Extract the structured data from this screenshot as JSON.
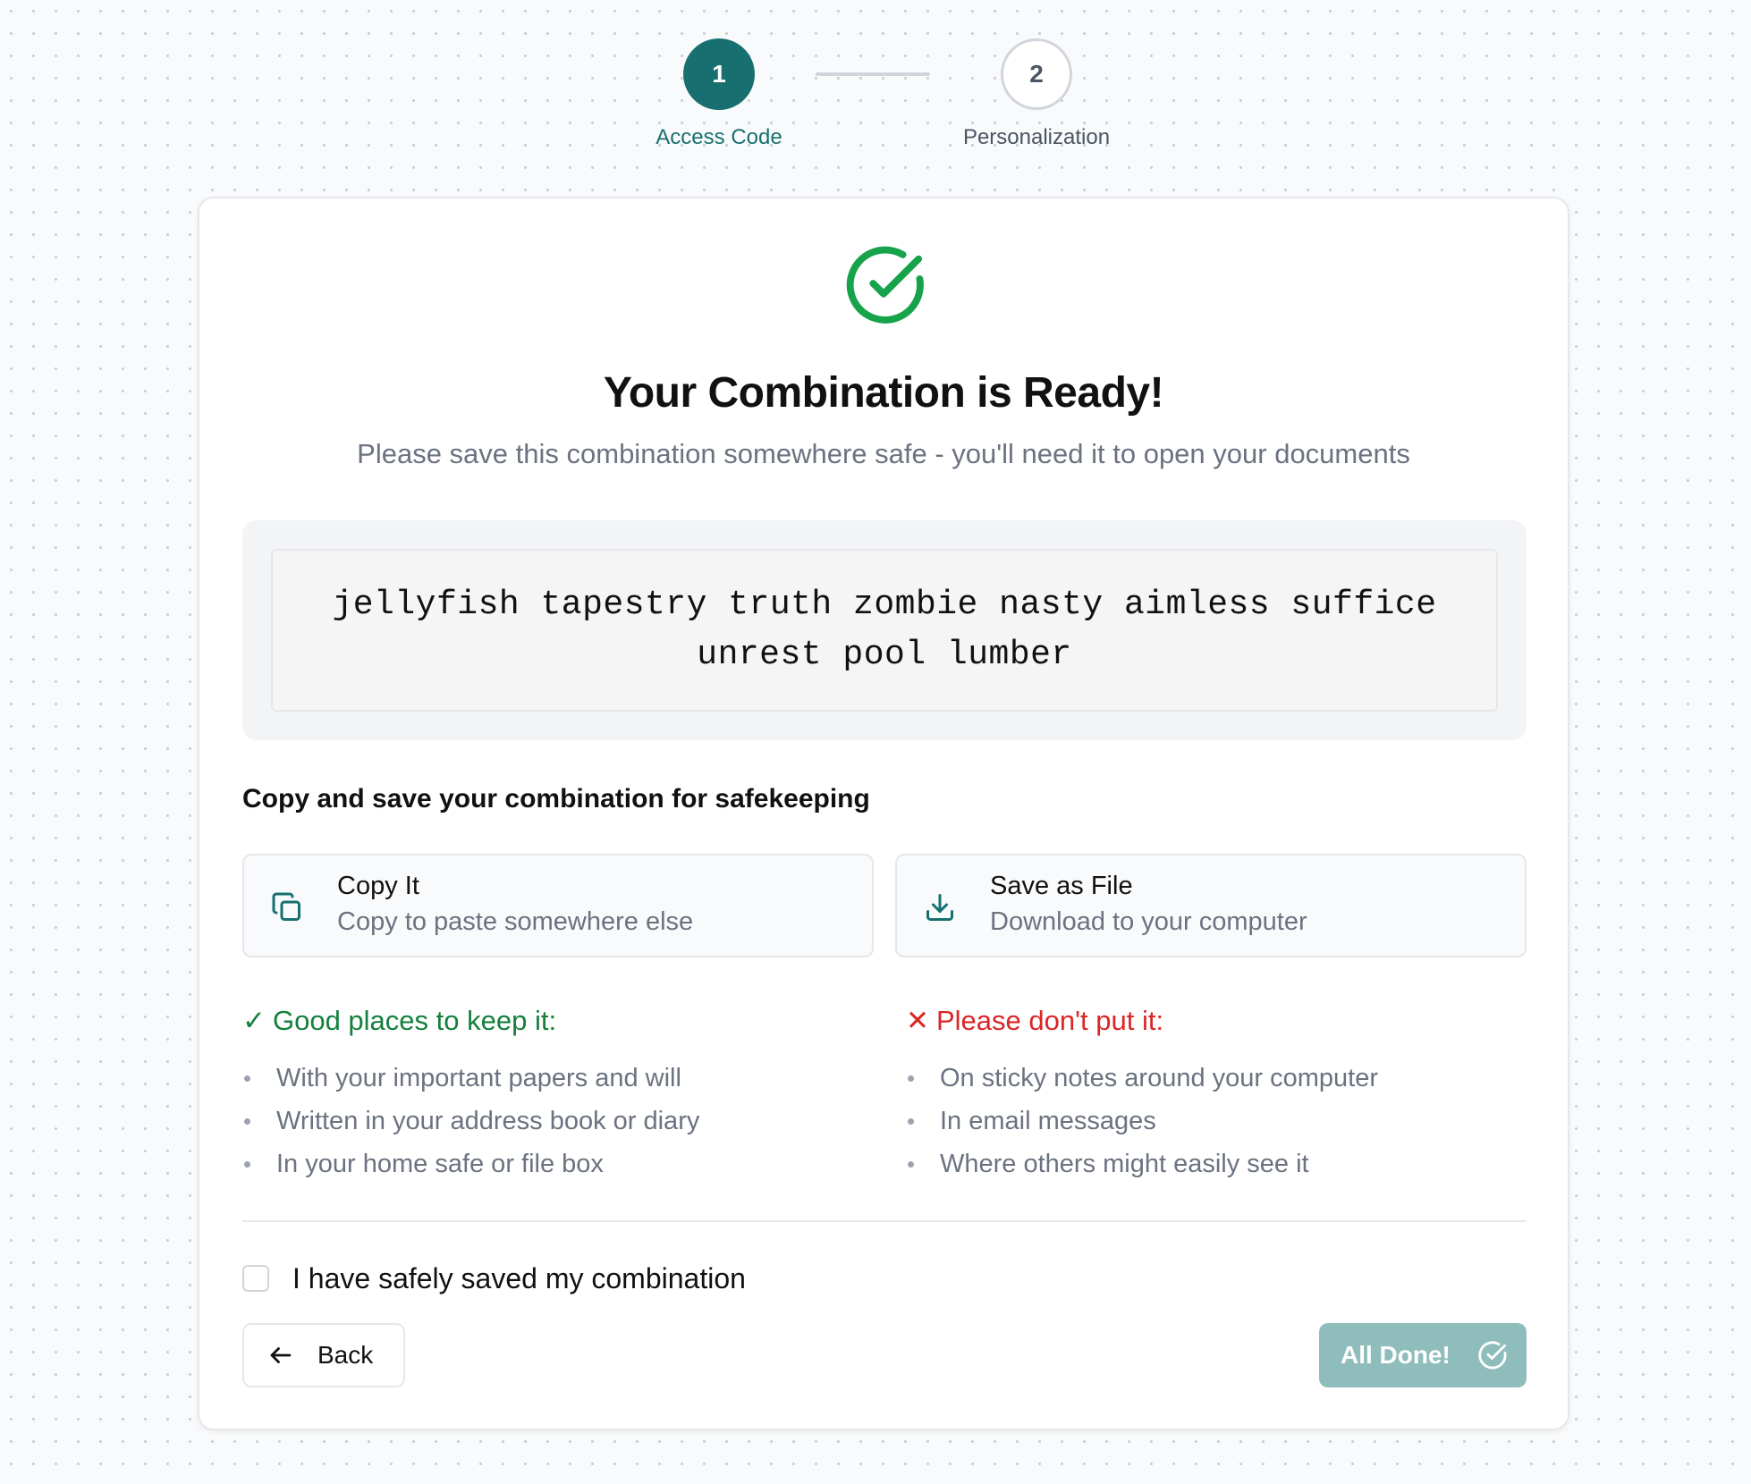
{
  "stepper": {
    "steps": [
      {
        "number": "1",
        "label": "Access Code",
        "state": "active"
      },
      {
        "number": "2",
        "label": "Personalization",
        "state": "inactive"
      }
    ]
  },
  "card": {
    "icon": "check-circle-icon",
    "title": "Your Combination is Ready!",
    "subtitle": "Please save this combination somewhere safe - you'll need it to open your documents",
    "combination": "jellyfish tapestry truth zombie nasty aimless suffice unrest pool lumber",
    "save_heading": "Copy and save your combination for safekeeping",
    "actions": {
      "copy": {
        "icon": "copy-icon",
        "title": "Copy It",
        "subtitle": "Copy to paste somewhere else"
      },
      "save": {
        "icon": "download-icon",
        "title": "Save as File",
        "subtitle": "Download to your computer"
      }
    },
    "good_places": {
      "mark": "✓",
      "heading": "Good places to keep it:",
      "items": [
        "With your important papers and will",
        "Written in your address book or diary",
        "In your home safe or file box"
      ]
    },
    "bad_places": {
      "mark": "✕",
      "heading": "Please don't put it:",
      "items": [
        "On sticky notes around your computer",
        "In email messages",
        "Where others might easily see it"
      ]
    },
    "confirm": {
      "label": "I have safely saved my combination",
      "checked": false
    },
    "back_button": {
      "label": "Back",
      "icon": "arrow-left-icon"
    },
    "done_button": {
      "label": "All Done!",
      "icon": "check-circle-icon",
      "enabled": false
    }
  },
  "colors": {
    "primary": "#17706f",
    "primary_disabled": "#8fbdbb",
    "success": "#16a34a",
    "good": "#15803d",
    "bad": "#dc2626",
    "muted_text": "#6b7280"
  }
}
